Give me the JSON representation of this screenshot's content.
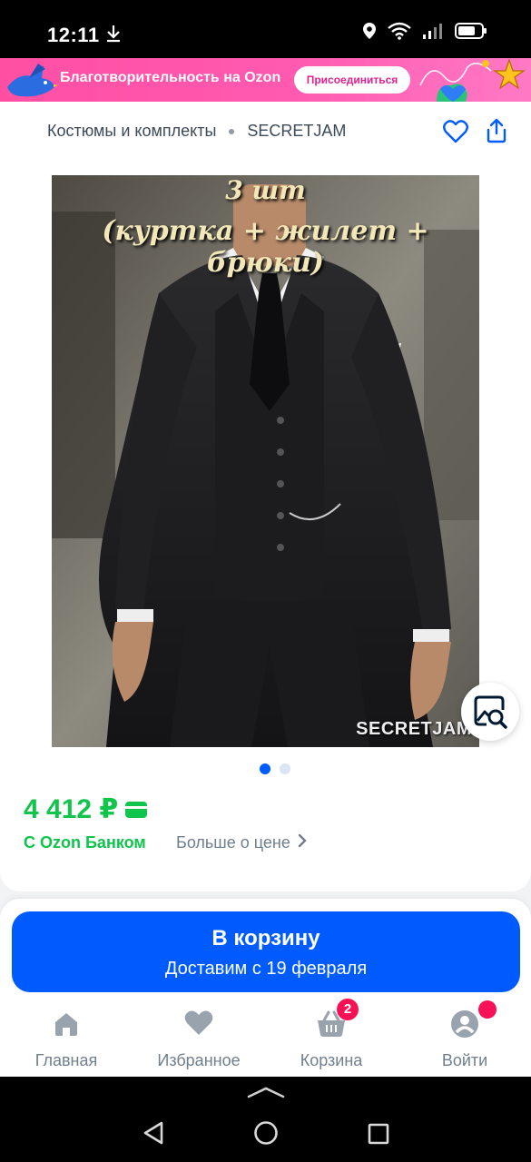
{
  "status_bar": {
    "time": "12:11",
    "icons": [
      "download-icon",
      "location-icon",
      "wifi-icon",
      "signal-icon",
      "battery-icon"
    ]
  },
  "promo": {
    "text": "Благотворительность на Ozon",
    "button_label": "Присоединиться",
    "color": "#ff4fa3"
  },
  "breadcrumb": {
    "category": "Костюмы и комплекты",
    "brand": "SECRETJAM"
  },
  "product": {
    "image_overlay_line1": "3 шт",
    "image_overlay_line2": "(куртка + жилет + брюки)",
    "image_brand_watermark": "SECRETJAM",
    "gallery_count": 2,
    "gallery_active_index": 0,
    "price": "4 412 ₽",
    "bank_label": "С Ozon Банком",
    "more_price_label": "Больше о цене"
  },
  "cart_button": {
    "title": "В корзину",
    "subtitle": "Доставим с 19 февраля",
    "color": "#005bff"
  },
  "bottom_nav": {
    "items": [
      {
        "label": "Главная",
        "icon": "home-icon"
      },
      {
        "label": "Избранное",
        "icon": "heart-icon"
      },
      {
        "label": "Корзина",
        "icon": "basket-icon",
        "badge": "2"
      },
      {
        "label": "Войти",
        "icon": "profile-icon"
      }
    ]
  },
  "colors": {
    "price_green": "#10c44c",
    "accent_blue": "#005bff",
    "badge_red": "#f91155"
  }
}
